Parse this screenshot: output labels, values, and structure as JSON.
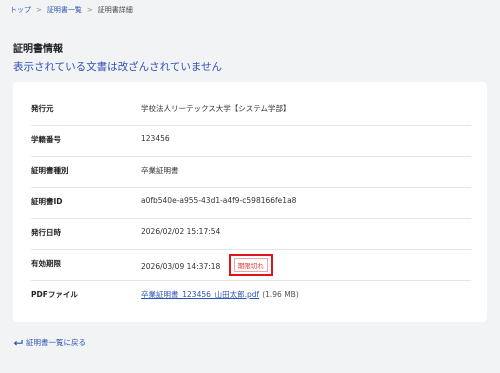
{
  "breadcrumb": {
    "items": [
      "トップ",
      "証明書一覧",
      "証明書詳細"
    ],
    "separator": ">"
  },
  "page_title": "証明書情報",
  "verify_note": "表示されている文書は改ざんされていません",
  "details": [
    {
      "label": "発行元",
      "value": "学校法人リーテックス大学【システム学部】"
    },
    {
      "label": "学籍番号",
      "value": "123456"
    },
    {
      "label": "証明書種別",
      "value": "卒業証明書"
    },
    {
      "label": "証明書ID",
      "value": "a0fb540e-a955-43d1-a4f9-c598166fe1a8"
    },
    {
      "label": "発行日時",
      "value": "2026/02/02 15:17:54"
    },
    {
      "label": "有効期限",
      "value": "2026/03/09 14:37:18",
      "badge": "期限切れ"
    },
    {
      "label": "PDFファイル",
      "file_name": "卒業証明書_123456_山田太郎.pdf",
      "file_size": "(1.96 MB)"
    }
  ],
  "back_link": "証明書一覧に戻る",
  "colors": {
    "link": "#2d52b6",
    "badge_border": "#e0151a",
    "background": "#f2f3f5"
  }
}
